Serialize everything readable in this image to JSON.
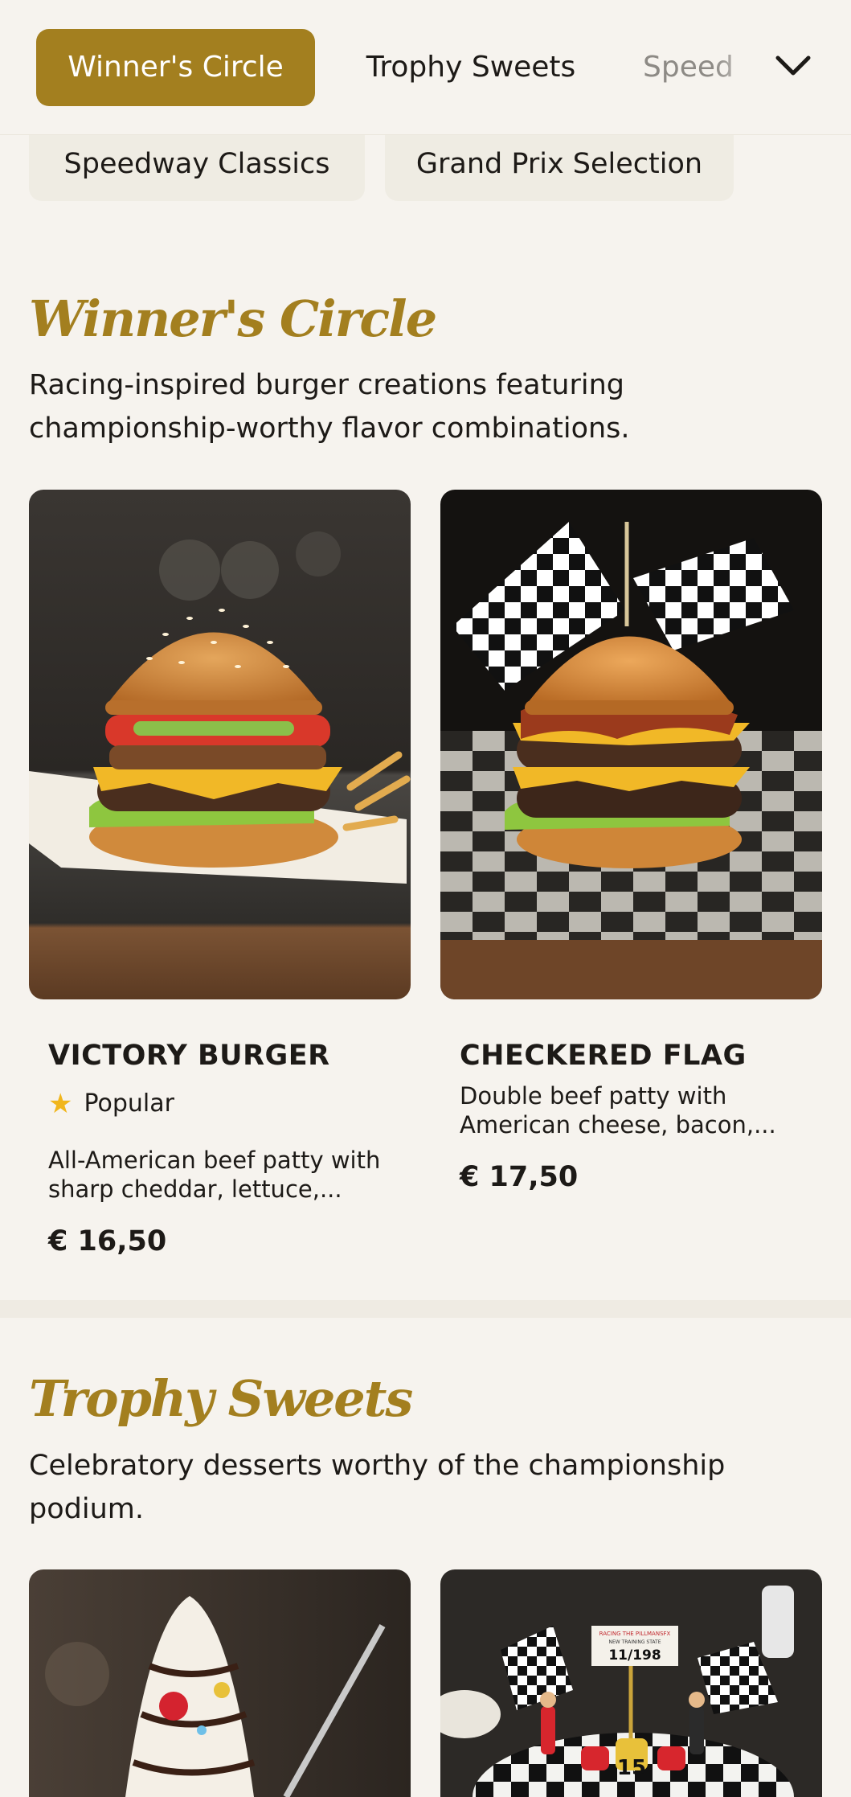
{
  "nav": {
    "tabs": [
      {
        "label": "Winner's Circle",
        "active": true
      },
      {
        "label": "Trophy Sweets",
        "active": false
      },
      {
        "label": "Speed",
        "active": false
      }
    ],
    "more_icon": "chevron-down-icon",
    "second_row": [
      {
        "label": "Speedway Classics"
      },
      {
        "label": "Grand Prix Selection"
      }
    ]
  },
  "colors": {
    "accent": "#a37f1f",
    "background": "#f6f3ee",
    "chip": "#efece3",
    "star": "#f1b61c"
  },
  "sections": [
    {
      "title": "Winner's Circle",
      "description": "Racing-inspired burger creations featuring championship-worthy flavor combinations.",
      "items": [
        {
          "name": "VICTORY BURGER",
          "badge": "Popular",
          "badge_icon": "star-icon",
          "description": "All-American beef patty with sharp cheddar, lettuce,...",
          "price": "€ 16,50"
        },
        {
          "name": "CHECKERED FLAG",
          "description": "Double beef patty with American cheese, bacon,...",
          "price": "€ 17,50"
        }
      ]
    },
    {
      "title": "Trophy Sweets",
      "description": "Celebratory desserts worthy of the championship podium.",
      "items": [
        {
          "image_text": [
            "RACING THE PILLMANSFX",
            "NEW TRAINING STATE",
            "11/198",
            "15"
          ]
        }
      ]
    }
  ]
}
